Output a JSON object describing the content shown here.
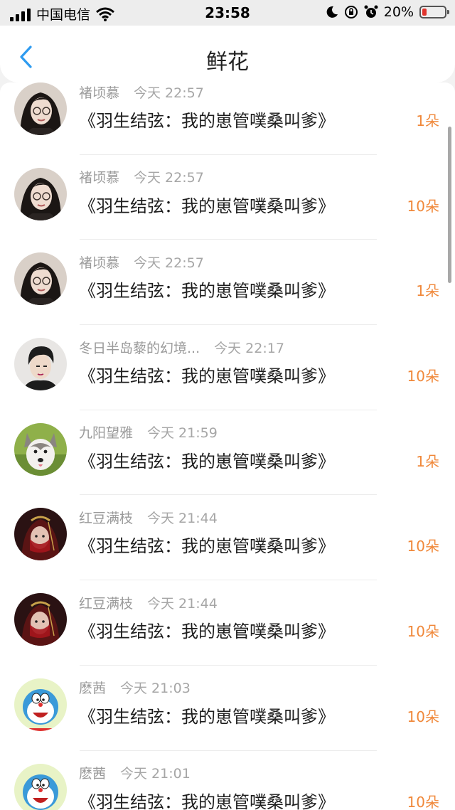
{
  "status_bar": {
    "carrier": "中国电信",
    "time": "23:58",
    "battery_percent_label": "20%",
    "battery_level": 0.2,
    "icons": [
      "signal-icon",
      "wifi-icon",
      "moon-icon",
      "orientation-lock-icon",
      "alarm-icon",
      "battery-icon"
    ]
  },
  "header": {
    "title": "鲜花",
    "back_icon": "chevron-left-icon",
    "accent_color": "#2e9bf0"
  },
  "colors": {
    "count_color": "#f0883a",
    "meta_color": "#9a9a9a",
    "title_color": "#1e1e1e"
  },
  "items": [
    {
      "user": "褚顷慕",
      "time": "今天 22:57",
      "book": "《羽生结弦：我的崽管噗桑叫爹》",
      "count": "1朵",
      "avatar": "portrait-glasses-avatar"
    },
    {
      "user": "褚顷慕",
      "time": "今天 22:57",
      "book": "《羽生结弦：我的崽管噗桑叫爹》",
      "count": "10朵",
      "avatar": "portrait-glasses-avatar"
    },
    {
      "user": "褚顷慕",
      "time": "今天 22:57",
      "book": "《羽生结弦：我的崽管噗桑叫爹》",
      "count": "1朵",
      "avatar": "portrait-glasses-avatar"
    },
    {
      "user": "冬日半岛藜的幻境...",
      "time": "今天 22:17",
      "book": "《羽生结弦：我的崽管噗桑叫爹》",
      "count": "10朵",
      "avatar": "portrait-boy-avatar"
    },
    {
      "user": "九阳望雅",
      "time": "今天 21:59",
      "book": "《羽生结弦：我的崽管噗桑叫爹》",
      "count": "1朵",
      "avatar": "husky-dog-avatar"
    },
    {
      "user": "红豆满枝",
      "time": "今天 21:44",
      "book": "《羽生结弦：我的崽管噗桑叫爹》",
      "count": "10朵",
      "avatar": "red-veil-avatar"
    },
    {
      "user": "红豆满枝",
      "time": "今天 21:44",
      "book": "《羽生结弦：我的崽管噗桑叫爹》",
      "count": "10朵",
      "avatar": "red-veil-avatar"
    },
    {
      "user": "麽茜",
      "time": "今天 21:03",
      "book": "《羽生结弦：我的崽管噗桑叫爹》",
      "count": "10朵",
      "avatar": "doraemon-avatar"
    },
    {
      "user": "麽茜",
      "time": "今天 21:01",
      "book": "《羽生结弦：我的崽管噗桑叫爹》",
      "count": "10朵",
      "avatar": "doraemon-avatar"
    }
  ]
}
